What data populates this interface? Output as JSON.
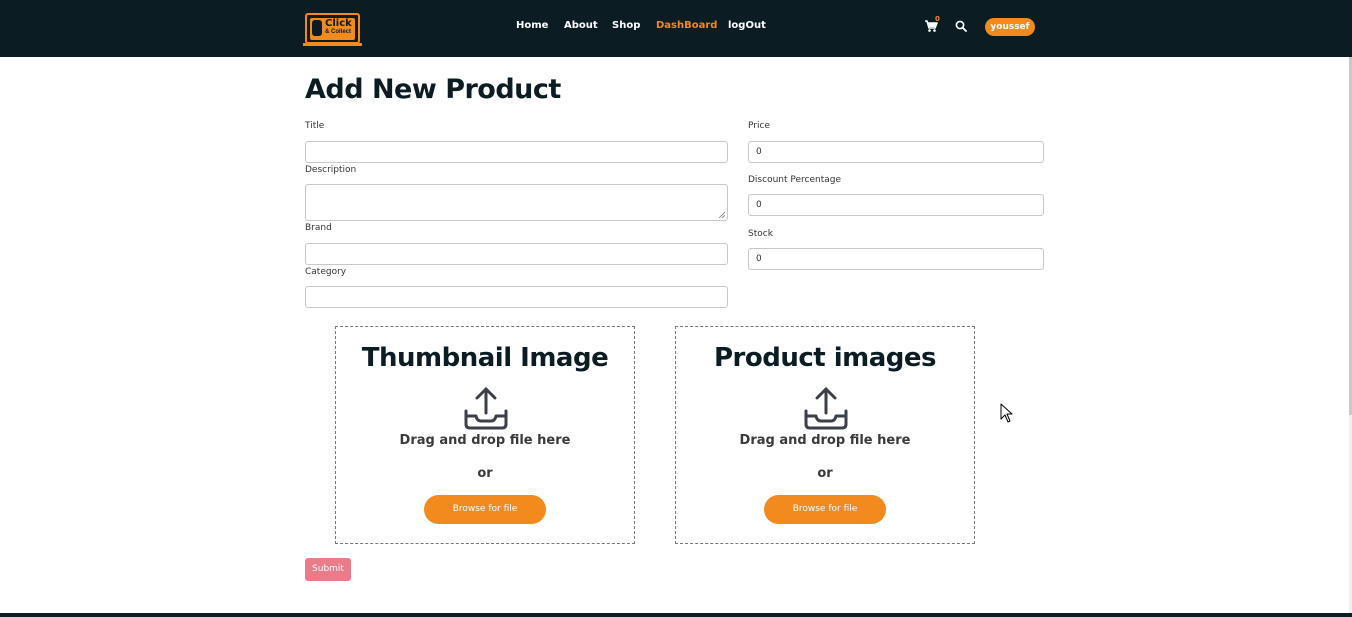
{
  "nav": {
    "logo_text": "Click",
    "logo_sub": "& Collect",
    "links": [
      {
        "label": "Home"
      },
      {
        "label": "About"
      },
      {
        "label": "Shop"
      },
      {
        "label": "DashBoard",
        "active": true
      },
      {
        "label": "logOut"
      }
    ],
    "cart_count": "0",
    "cart_icon": "cart-icon",
    "search_icon": "search-icon",
    "user": "youssef"
  },
  "form": {
    "title": "Add New Product",
    "fields": {
      "title": {
        "label": "Title",
        "value": ""
      },
      "description": {
        "label": "Description",
        "value": ""
      },
      "brand": {
        "label": "Brand",
        "value": ""
      },
      "category": {
        "label": "Category",
        "value": ""
      },
      "price": {
        "label": "Price",
        "value": "0"
      },
      "discount": {
        "label": "Discount Percentage",
        "value": "0"
      },
      "stock": {
        "label": "Stock",
        "value": "0"
      }
    },
    "dropzones": [
      {
        "title": "Thumbnail Image",
        "drag_text": "Drag and drop file here",
        "or_text": "or",
        "button": "Browse for file",
        "icon": "upload-icon"
      },
      {
        "title": "Product images",
        "drag_text": "Drag and drop file here",
        "or_text": "or",
        "button": "Browse for file",
        "icon": "upload-icon"
      }
    ],
    "submit": "Submit"
  },
  "colors": {
    "navbar": "#0b1c23",
    "accent": "#f28a1e",
    "submit": "#ea7b88"
  }
}
